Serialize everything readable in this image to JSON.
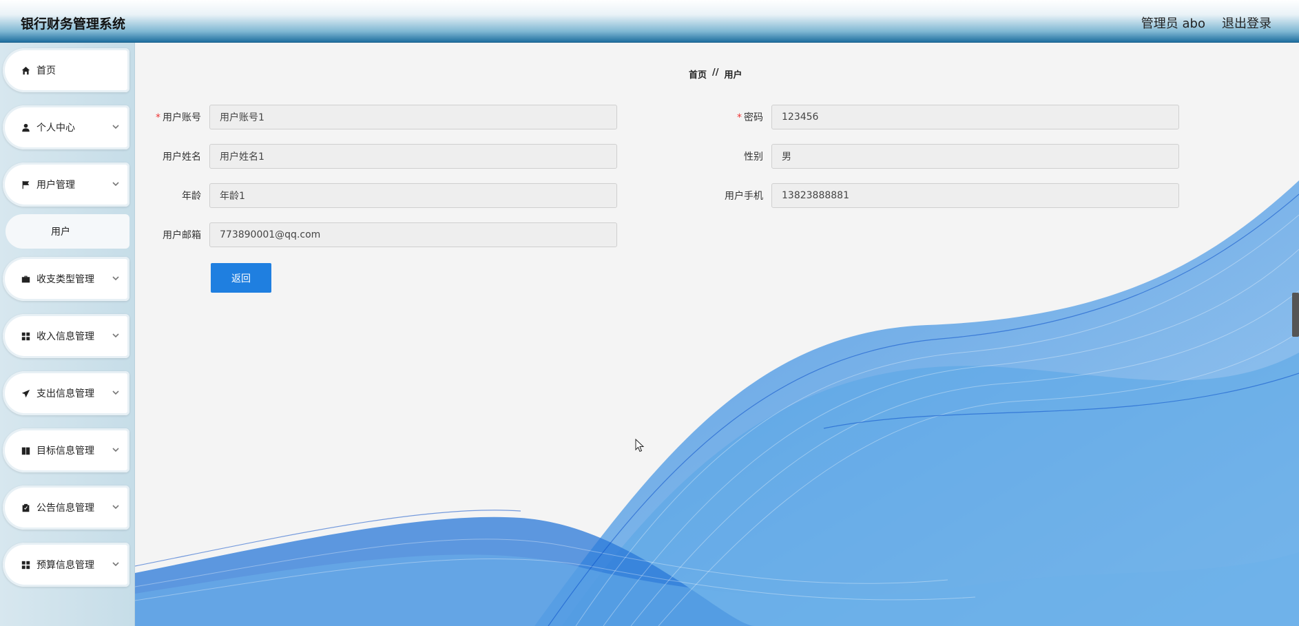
{
  "app": {
    "title": "银行财务管理系统"
  },
  "header": {
    "user_label": "管理员 abo",
    "logout_label": "退出登录"
  },
  "sidebar": {
    "items": [
      {
        "label": "首页",
        "icon": "home-icon"
      },
      {
        "label": "个人中心",
        "icon": "user-icon"
      },
      {
        "label": "用户管理",
        "icon": "flag-icon",
        "expanded": true
      },
      {
        "label": "收支类型管理",
        "icon": "briefcase-icon"
      },
      {
        "label": "收入信息管理",
        "icon": "grid-icon"
      },
      {
        "label": "支出信息管理",
        "icon": "send-icon"
      },
      {
        "label": "目标信息管理",
        "icon": "book-icon"
      },
      {
        "label": "公告信息管理",
        "icon": "clipboard-icon"
      },
      {
        "label": "预算信息管理",
        "icon": "grid-icon"
      }
    ],
    "sub_item": {
      "label": "用户"
    }
  },
  "breadcrumb": {
    "home": "首页",
    "separator": "//",
    "current": "用户"
  },
  "form": {
    "account": {
      "label": "用户账号",
      "required": true,
      "value": "用户账号1"
    },
    "password": {
      "label": "密码",
      "required": true,
      "value": "123456"
    },
    "name": {
      "label": "用户姓名",
      "value": "用户姓名1"
    },
    "gender": {
      "label": "性别",
      "value": "男"
    },
    "age": {
      "label": "年龄",
      "value": "年龄1"
    },
    "phone": {
      "label": "用户手机",
      "value": "13823888881"
    },
    "email": {
      "label": "用户邮箱",
      "value": "773890001@qq.com"
    },
    "back_label": "返回"
  },
  "colors": {
    "accent": "#1f7fe0",
    "header_dark": "#1f6f9f",
    "wave": "#1e6fd9"
  }
}
